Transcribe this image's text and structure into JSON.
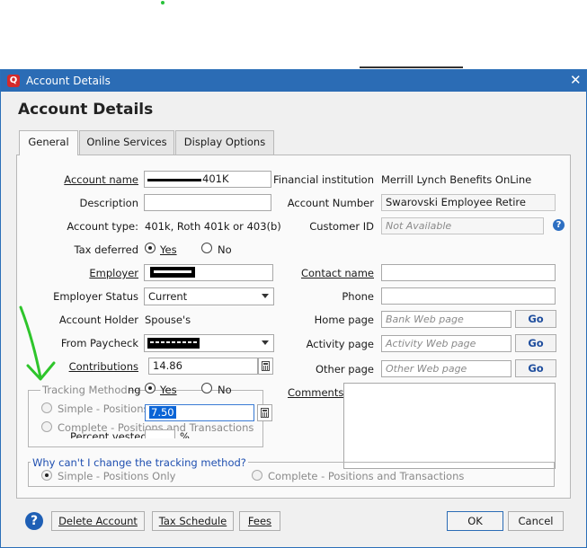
{
  "window": {
    "title": "Account Details",
    "heading": "Account Details",
    "close_glyph": "✕",
    "app_icon_letter": "Q"
  },
  "tabs": [
    {
      "label": "General",
      "active": true
    },
    {
      "label": "Online Services",
      "active": false
    },
    {
      "label": "Display Options",
      "active": false
    }
  ],
  "left": {
    "account_name_label": "Account name",
    "account_name_value": "401K",
    "description_label": "Description",
    "description_value": "",
    "account_type_label": "Account type:",
    "account_type_value": "401k, Roth 401k or 403(b)",
    "tax_deferred_label": "Tax deferred",
    "yes": "Yes",
    "no": "No",
    "employer_label": "Employer",
    "employer_status_label": "Employer Status",
    "employer_status_value": "Current",
    "account_holder_label": "Account Holder",
    "account_holder_value": "Spouse's",
    "from_paycheck_label": "From Paycheck",
    "contributions_label": "Contributions",
    "contributions_value": "14.86"
  },
  "right": {
    "fin_inst_label": "Financial institution",
    "fin_inst_value": "Merrill Lynch Benefits OnLine",
    "account_number_label": "Account Number",
    "account_number_value": "Swarovski Employee Retire",
    "customer_id_label": "Customer ID",
    "customer_id_placeholder": "Not Available",
    "contact_name_label": "Contact name",
    "phone_label": "Phone",
    "home_page_label": "Home page",
    "home_page_placeholder": "Bank Web page",
    "activity_page_label": "Activity page",
    "activity_page_placeholder": "Activity Web page",
    "other_page_label": "Other page",
    "other_page_placeholder": "Other Web page",
    "go_label": "Go",
    "comments_label": "Comments"
  },
  "overlay": {
    "tracking_method_label": "Tracking Method",
    "ng_fragment": "ng",
    "yes": "Yes",
    "no": "No",
    "simple_label": "Simple - Positions",
    "complete_label": "Complete - Positions and Transactions",
    "edit_value": "7.50",
    "percent_vested_label": "Percent vested",
    "percent_sign": "%"
  },
  "tracking": {
    "why_link": "Why can't I change the tracking method?",
    "simple_only": "Simple - Positions Only",
    "complete": "Complete - Positions and Transactions"
  },
  "buttons": {
    "help_glyph": "?",
    "delete": "Delete Account",
    "tax_schedule": "Tax Schedule",
    "fees": "Fees",
    "ok": "OK",
    "cancel": "Cancel"
  },
  "colors": {
    "titlebar": "#2b6cb5",
    "link": "#1f4fb0",
    "annotation_arrow": "#2ec52b",
    "selection": "#0a64d6"
  }
}
